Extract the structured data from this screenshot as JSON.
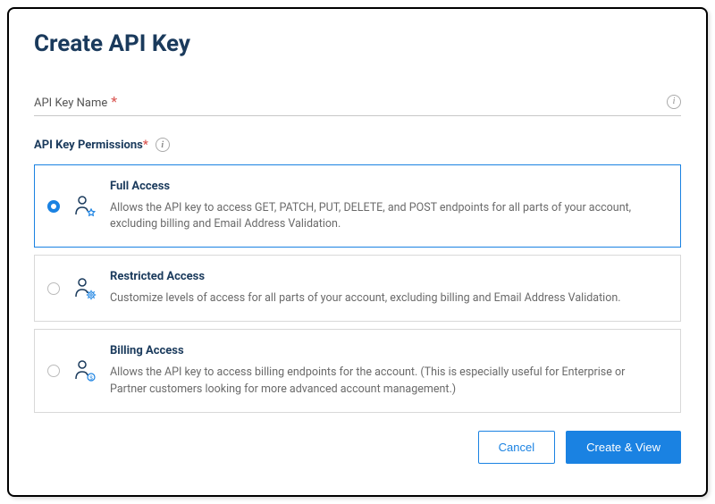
{
  "title": "Create API Key",
  "nameField": {
    "label": "API Key Name",
    "value": ""
  },
  "permissionsLabel": "API Key Permissions",
  "permissions": [
    {
      "id": "full",
      "title": "Full Access",
      "desc": "Allows the API key to access GET, PATCH, PUT, DELETE, and POST endpoints for all parts of your account, excluding billing and Email Address Validation.",
      "selected": true
    },
    {
      "id": "restricted",
      "title": "Restricted Access",
      "desc": "Customize levels of access for all parts of your account, excluding billing and Email Address Validation.",
      "selected": false
    },
    {
      "id": "billing",
      "title": "Billing Access",
      "desc": "Allows the API key to access billing endpoints for the account. (This is especially useful for Enterprise or Partner customers looking for more advanced account management.)",
      "selected": false
    }
  ],
  "buttons": {
    "cancel": "Cancel",
    "submit": "Create & View"
  }
}
